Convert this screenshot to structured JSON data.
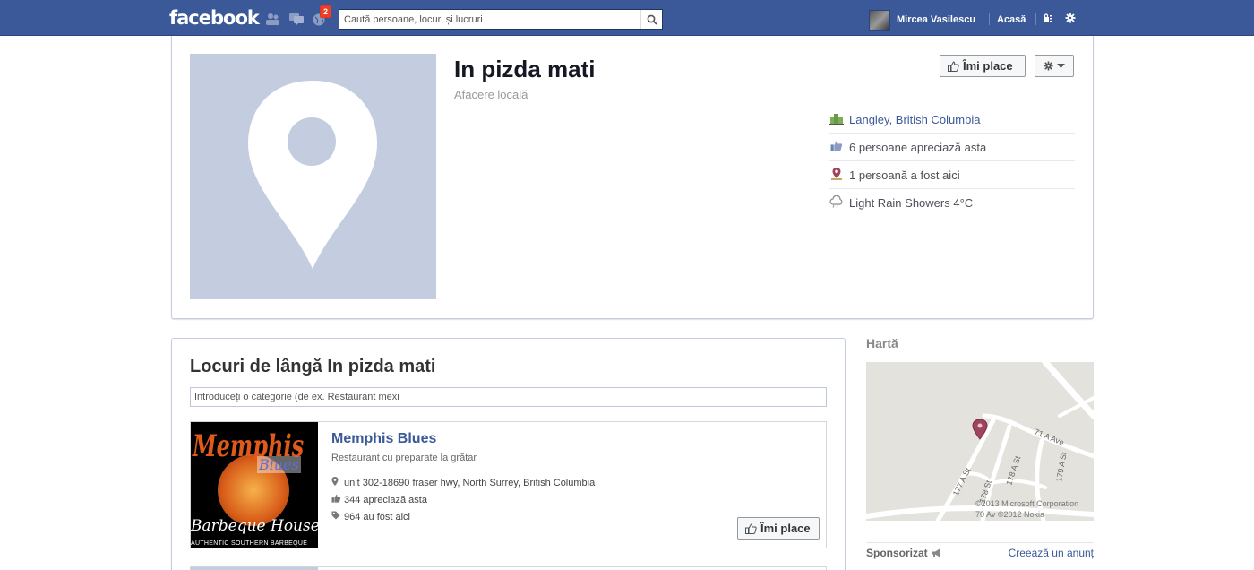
{
  "topbar": {
    "logo": "facebook",
    "notifications_count": "2",
    "search_placeholder": "Caută persoane, locuri și lucruri",
    "user_name": "Mircea Vasilescu",
    "home_label": "Acasă"
  },
  "page": {
    "title": "In pizda mati",
    "category": "Afacere locală",
    "like_label": "Îmi place",
    "info": [
      {
        "icon": "city-icon",
        "text": "Langley, British Columbia"
      },
      {
        "icon": "thumbs-up-icon",
        "text": "6 persoane apreciază asta"
      },
      {
        "icon": "person-pin-icon",
        "text": "1 persoană a fost aici"
      },
      {
        "icon": "weather-cloud-icon",
        "text": "Light Rain Showers 4°C"
      }
    ]
  },
  "nearby": {
    "title": "Locuri de lângă In pizda mati",
    "category_placeholder": "Introduceți o categorie (de ex. Restaurant mexi",
    "places": [
      {
        "name": "Memphis Blues",
        "category": "Restaurant cu preparate la grătar",
        "address": "unit 302-18690 fraser hwy, North Surrey, British Columbia",
        "likes": "344 apreciază asta",
        "checkins": "964 au fost aici",
        "like_label": "Îmi place",
        "image_text": {
          "top": "Memphis",
          "middle": "Blues",
          "bottom": "Barbeque House",
          "tagline": "AUTHENTIC SOUTHERN BARBEQUE"
        }
      }
    ]
  },
  "map": {
    "label": "Hartă",
    "streets": [
      "71 A Ave",
      "177 A St",
      "178 A St",
      "179 A St",
      "178 St",
      "70 Av"
    ],
    "copyright_1": "©2013 Microsoft Corporation",
    "copyright_2": "©2012 Nokia"
  },
  "sponsored": {
    "label": "Sponsorizat",
    "create_ad": "Creează un anunț"
  },
  "colors": {
    "brand": "#3b5998",
    "placeholder_bg": "#c4cde0",
    "map_pin": "#a0435c"
  }
}
